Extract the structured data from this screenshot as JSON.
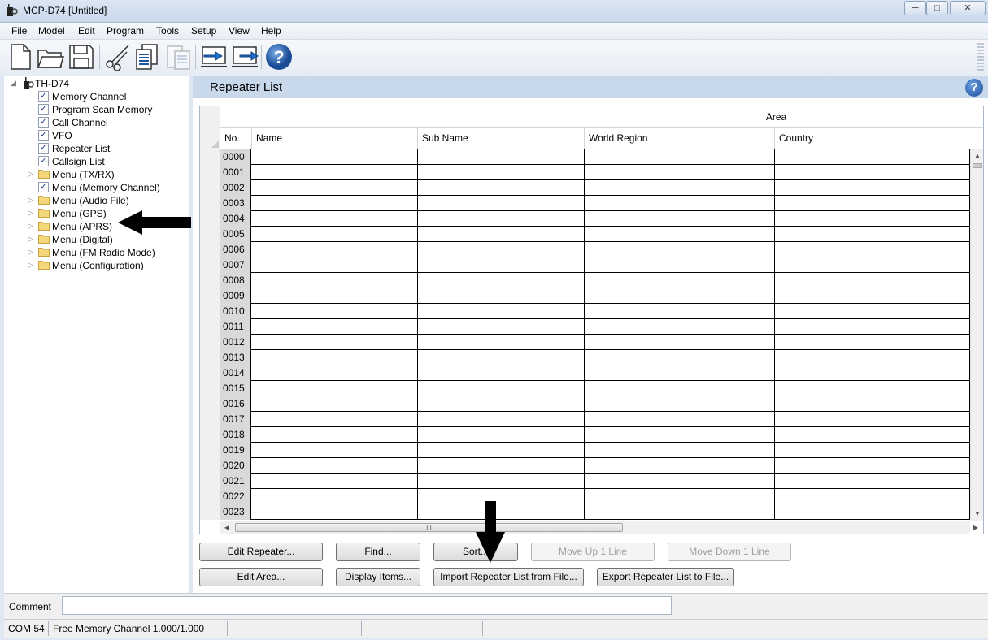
{
  "window": {
    "title": "MCP-D74 [Untitled]",
    "controls": {
      "minimize": "─",
      "maximize": "□",
      "close": "✕"
    }
  },
  "menu": [
    "File",
    "Model",
    "Edit",
    "Program",
    "Tools",
    "Setup",
    "View",
    "Help"
  ],
  "toolbar": {
    "icons": [
      "new-file-icon",
      "open-folder-icon",
      "save-icon",
      "cut-icon",
      "copy-icon",
      "paste-icon",
      "read-from-radio-icon",
      "write-to-radio-icon",
      "help-icon"
    ],
    "help_glyph": "?"
  },
  "tree": {
    "root": "TH-D74",
    "expander": "◢",
    "collapsed_glyph": "▷",
    "check_glyph": "✓",
    "items": [
      {
        "label": "Memory Channel",
        "kind": "check"
      },
      {
        "label": "Program Scan Memory",
        "kind": "check"
      },
      {
        "label": "Call Channel",
        "kind": "check"
      },
      {
        "label": "VFO",
        "kind": "check"
      },
      {
        "label": "Repeater List",
        "kind": "check"
      },
      {
        "label": "Callsign List",
        "kind": "check"
      },
      {
        "label": "Menu (TX/RX)",
        "kind": "folder"
      },
      {
        "label": "Menu (Memory Channel)",
        "kind": "check"
      },
      {
        "label": "Menu (Audio File)",
        "kind": "folder"
      },
      {
        "label": "Menu (GPS)",
        "kind": "folder"
      },
      {
        "label": "Menu (APRS)",
        "kind": "folder"
      },
      {
        "label": "Menu (Digital)",
        "kind": "folder"
      },
      {
        "label": "Menu (FM Radio Mode)",
        "kind": "folder"
      },
      {
        "label": "Menu (Configuration)",
        "kind": "folder"
      }
    ]
  },
  "main": {
    "title": "Repeater List",
    "help_glyph": "?",
    "grid": {
      "group_header": "Area",
      "columns": [
        "No.",
        "Name",
        "Sub Name",
        "World Region",
        "Country"
      ],
      "rows": [
        "0000",
        "0001",
        "0002",
        "0003",
        "0004",
        "0005",
        "0006",
        "0007",
        "0008",
        "0009",
        "0010",
        "0011",
        "0012",
        "0013",
        "0014",
        "0015",
        "0016",
        "0017",
        "0018",
        "0019",
        "0020",
        "0021",
        "0022",
        "0023"
      ],
      "scroll_glyphs": {
        "up": "▲",
        "down": "▼",
        "left": "◀",
        "right": "▶",
        "grip": "III"
      }
    },
    "buttons": {
      "edit_repeater": "Edit Repeater...",
      "find": "Find...",
      "sort": "Sort...",
      "move_up": "Move Up 1 Line",
      "move_down": "Move Down 1 Line",
      "edit_area": "Edit Area...",
      "display_items": "Display Items...",
      "import": "Import Repeater List from File...",
      "export": "Export Repeater List to File..."
    }
  },
  "comment": {
    "label": "Comment",
    "value": ""
  },
  "status": {
    "port": "COM 54",
    "memory": "Free Memory Channel 1.000/1.000"
  },
  "colors": {
    "header_band": "#c9d9ec",
    "row_header": "#d9d9d9",
    "annotation_arrow": "#000000"
  }
}
